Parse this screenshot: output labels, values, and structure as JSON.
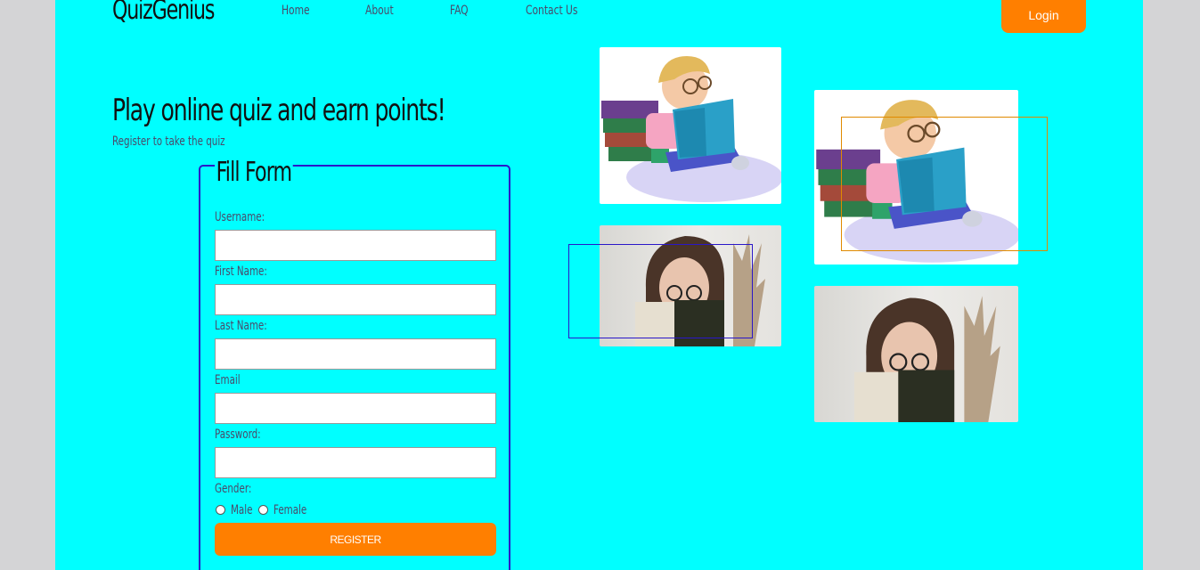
{
  "brand": {
    "name": "QuizGenius"
  },
  "nav": {
    "items": [
      "Home",
      "About",
      "FAQ",
      "Contact Us"
    ],
    "login_label": "Login"
  },
  "hero": {
    "title": "Play online quiz and earn points!",
    "subtitle": "Register to take the quiz"
  },
  "form": {
    "legend": "Fill Form",
    "fields": [
      {
        "label": "Username:",
        "value": ""
      },
      {
        "label": "First Name:",
        "value": ""
      },
      {
        "label": "Last Name:",
        "value": ""
      },
      {
        "label": "Email",
        "value": ""
      },
      {
        "label": "Password:",
        "value": ""
      }
    ],
    "gender_label": "Gender:",
    "gender_options": [
      "Male",
      "Female"
    ],
    "register_label": "REGISTER"
  },
  "images": [
    {
      "name": "boy-reading-illustration"
    },
    {
      "name": "woman-with-book-photo"
    }
  ],
  "colors": {
    "page_bg": "#00ffff",
    "outer_bg": "#d4d4d6",
    "accent_orange": "#ff7f00",
    "fieldset_border": "#2a17c8",
    "selection_blue": "#2a17c8",
    "selection_orange": "#e08a00"
  }
}
